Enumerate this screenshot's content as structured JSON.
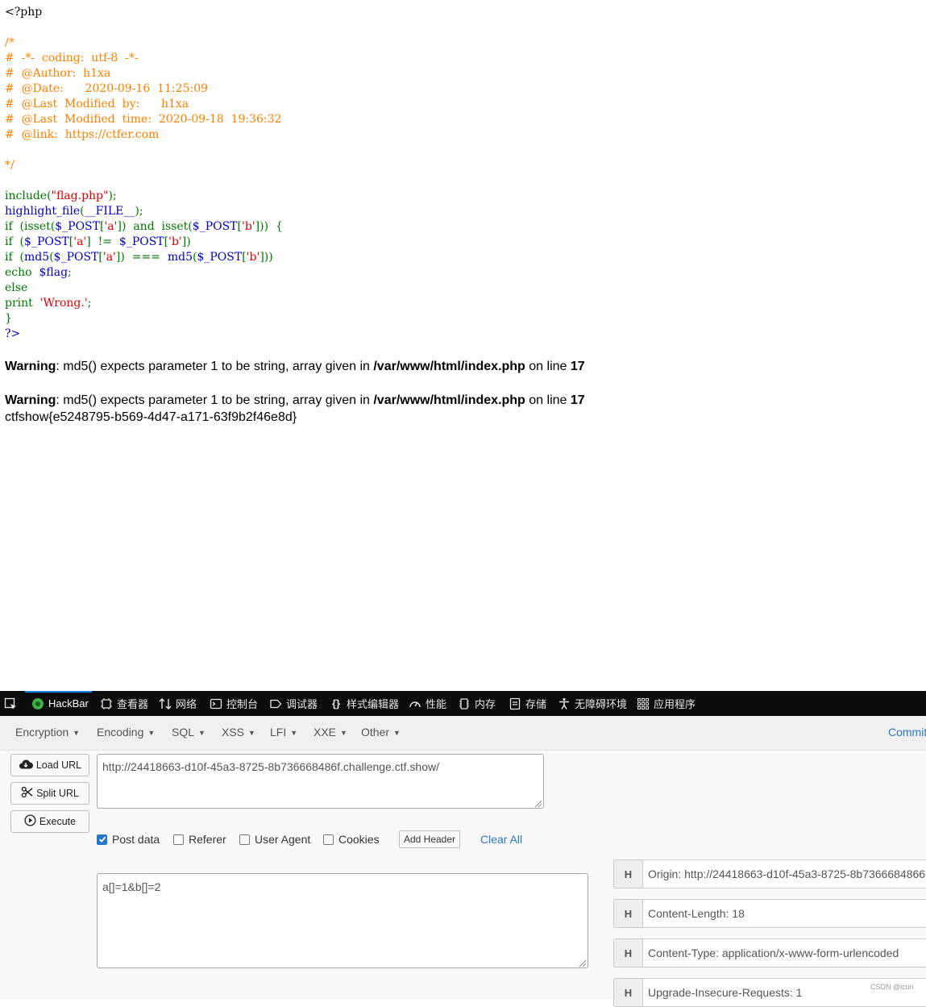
{
  "source_lines": [
    [
      [
        "html",
        "<?php"
      ]
    ],
    [
      [
        "html",
        ""
      ]
    ],
    [
      [
        "cm",
        "/*"
      ]
    ],
    [
      [
        "cm",
        "#  -*-  coding:  utf-8  -*-"
      ]
    ],
    [
      [
        "cm",
        "#  @Author:  h1xa"
      ]
    ],
    [
      [
        "cm",
        "#  @Date:      2020-09-16  11:25:09"
      ]
    ],
    [
      [
        "cm",
        "#  @Last  Modified  by:      h1xa"
      ]
    ],
    [
      [
        "cm",
        "#  @Last  Modified  time:  2020-09-18  19:36:32"
      ]
    ],
    [
      [
        "cm",
        "#  @link:  https://ctfer.com"
      ]
    ],
    [
      [
        "cm",
        ""
      ]
    ],
    [
      [
        "cm",
        "*/"
      ]
    ],
    [
      [
        "html",
        ""
      ]
    ],
    [
      [
        "kw",
        "include("
      ],
      [
        "str",
        "\"flag.php\""
      ],
      [
        "kw",
        ");"
      ]
    ],
    [
      [
        "def",
        "highlight_file"
      ],
      [
        "kw",
        "("
      ],
      [
        "def",
        "__FILE__"
      ],
      [
        "kw",
        ");"
      ]
    ],
    [
      [
        "kw",
        "if  (isset("
      ],
      [
        "def",
        "$_POST"
      ],
      [
        "kw",
        "["
      ],
      [
        "str",
        "'a'"
      ],
      [
        "kw",
        "])  and  isset("
      ],
      [
        "def",
        "$_POST"
      ],
      [
        "kw",
        "["
      ],
      [
        "str",
        "'b'"
      ],
      [
        "kw",
        "]))  {"
      ]
    ],
    [
      [
        "kw",
        "if  ("
      ],
      [
        "def",
        "$_POST"
      ],
      [
        "kw",
        "["
      ],
      [
        "str",
        "'a'"
      ],
      [
        "kw",
        "]  !=  "
      ],
      [
        "def",
        "$_POST"
      ],
      [
        "kw",
        "["
      ],
      [
        "str",
        "'b'"
      ],
      [
        "kw",
        "])"
      ]
    ],
    [
      [
        "kw",
        "if  ("
      ],
      [
        "def",
        "md5"
      ],
      [
        "kw",
        "("
      ],
      [
        "def",
        "$_POST"
      ],
      [
        "kw",
        "["
      ],
      [
        "str",
        "'a'"
      ],
      [
        "kw",
        "])  ===  "
      ],
      [
        "def",
        "md5"
      ],
      [
        "kw",
        "("
      ],
      [
        "def",
        "$_POST"
      ],
      [
        "kw",
        "["
      ],
      [
        "str",
        "'b'"
      ],
      [
        "kw",
        "]))"
      ]
    ],
    [
      [
        "kw",
        "echo  "
      ],
      [
        "def",
        "$flag"
      ],
      [
        "kw",
        ";"
      ]
    ],
    [
      [
        "kw",
        "else"
      ]
    ],
    [
      [
        "kw",
        "print  "
      ],
      [
        "str",
        "'Wrong.'"
      ],
      [
        "kw",
        ";"
      ]
    ],
    [
      [
        "kw",
        "}"
      ]
    ],
    [
      [
        "def",
        "?>"
      ]
    ]
  ],
  "warnings": [
    {
      "label": "Warning",
      "text": ": md5() expects parameter 1 to be string, array given in ",
      "file": "/var/www/html/index.php",
      "on": " on line ",
      "line": "17"
    },
    {
      "label": "Warning",
      "text": ": md5() expects parameter 1 to be string, array given in ",
      "file": "/var/www/html/index.php",
      "on": " on line ",
      "line": "17"
    }
  ],
  "flag_output": "ctfshow{e5248795-b569-4d47-a171-63f9b2f46e8d}",
  "devtools": {
    "tabs": [
      {
        "id": "hackbar",
        "label": "HackBar",
        "icon": "hackbar-icon"
      },
      {
        "id": "inspector",
        "label": "查看器",
        "icon": "inspector-icon"
      },
      {
        "id": "network",
        "label": "网络",
        "icon": "network-icon"
      },
      {
        "id": "console",
        "label": "控制台",
        "icon": "console-icon"
      },
      {
        "id": "debugger",
        "label": "调试器",
        "icon": "debugger-icon"
      },
      {
        "id": "style-editor",
        "label": "样式编辑器",
        "icon": "braces-icon"
      },
      {
        "id": "performance",
        "label": "性能",
        "icon": "gauge-icon"
      },
      {
        "id": "memory",
        "label": "内存",
        "icon": "chip-icon"
      },
      {
        "id": "storage",
        "label": "存储",
        "icon": "storage-icon"
      },
      {
        "id": "accessibility",
        "label": "无障碍环境",
        "icon": "accessibility-icon"
      },
      {
        "id": "application",
        "label": "应用程序",
        "icon": "grid-icon"
      }
    ],
    "active_tab": "HackBar"
  },
  "hackbar": {
    "menu": [
      "Encryption",
      "Encoding",
      "SQL",
      "XSS",
      "LFI",
      "XXE",
      "Other"
    ],
    "commit_label": "Commit",
    "buttons": {
      "load": "Load URL",
      "split": "Split URL",
      "execute": "Execute"
    },
    "url_value": "http://24418663-d10f-45a3-8725-8b736668486f.challenge.ctf.show/",
    "options": [
      {
        "label": "Post data",
        "checked": true
      },
      {
        "label": "Referer",
        "checked": false
      },
      {
        "label": "User Agent",
        "checked": false
      },
      {
        "label": "Cookies",
        "checked": false
      }
    ],
    "add_header_label": "Add Header",
    "clear_all_label": "Clear All",
    "post_data": "a[]=1&b[]=2",
    "headers": [
      {
        "badge": "H",
        "value": "Origin: http://24418663-d10f-45a3-8725-8b7366684866"
      },
      {
        "badge": "H",
        "value": "Content-Length: 18"
      },
      {
        "badge": "H",
        "value": "Content-Type: application/x-www-form-urlencoded"
      },
      {
        "badge": "H",
        "value": "Upgrade-Insecure-Requests: 1"
      }
    ]
  },
  "watermark": "CSDN @icun"
}
